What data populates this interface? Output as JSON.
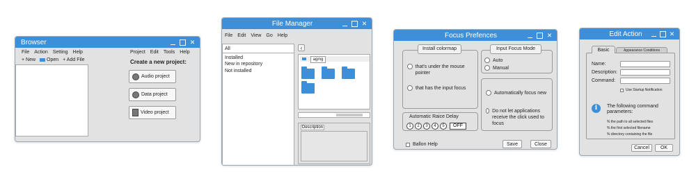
{
  "colors": {
    "titlebar": "#3d8fd9",
    "window_bg": "#e2e2e2",
    "panel_bg": "#ffffff",
    "info_icon": "#3d8fd9",
    "folder": "#3d8fd9"
  },
  "browser": {
    "title": "Browser",
    "menu_left": [
      "File",
      "Action",
      "Setting",
      "Help"
    ],
    "toolbar": {
      "new": "New",
      "open": "Open",
      "add_file": "Add File"
    },
    "menu_right": [
      "Project",
      "Edit",
      "Tools",
      "Help"
    ],
    "heading": "Create a new project:",
    "projects": [
      {
        "label": "Audio project",
        "icon": "audio-project-icon"
      },
      {
        "label": "Data project",
        "icon": "data-project-icon"
      },
      {
        "label": "Video project",
        "icon": "video-project-icon"
      }
    ]
  },
  "file_manager": {
    "title": "File Manager",
    "menu": [
      "File",
      "Edit",
      "View",
      "Go",
      "Help"
    ],
    "filters": [
      "All",
      "Installed",
      "New in repository",
      "Not installed"
    ],
    "path_chip": "aging",
    "description_label": "Description"
  },
  "focus_prefs": {
    "title": "Focus Prefences",
    "colormap_title": "Install colormap",
    "colormap_options": [
      "that's under the mouse pointer",
      "that has the input focus"
    ],
    "focus_mode_title": "Input Focus Mode",
    "focus_mode_options": [
      "Auto",
      "Manual"
    ],
    "focus_options": [
      "Automatically focus new",
      "Do not let applications receive the click used to focus"
    ],
    "raise_delay_title": "Automatic Raice Delay",
    "timer_labels": [
      "1",
      "2",
      "3",
      "4",
      "5"
    ],
    "off_label": "OFF",
    "balloon_help": "Ballon Help",
    "save": "Save",
    "close": "Close"
  },
  "edit_action": {
    "title": "Edit Action",
    "tabs": [
      "Basic",
      "Appearance Conditions"
    ],
    "fields": [
      "Name:",
      "Description:",
      "Command:"
    ],
    "startup_notification": "Use Startup Notification",
    "info_heading": "The following command parameters:",
    "params": [
      {
        "code": "%",
        "text": "the path to all selected files"
      },
      {
        "code": "%",
        "text": "the first selected filename"
      },
      {
        "code": "%",
        "text": "directory containing the file"
      }
    ],
    "cancel": "Cancel",
    "ok": "OK"
  }
}
